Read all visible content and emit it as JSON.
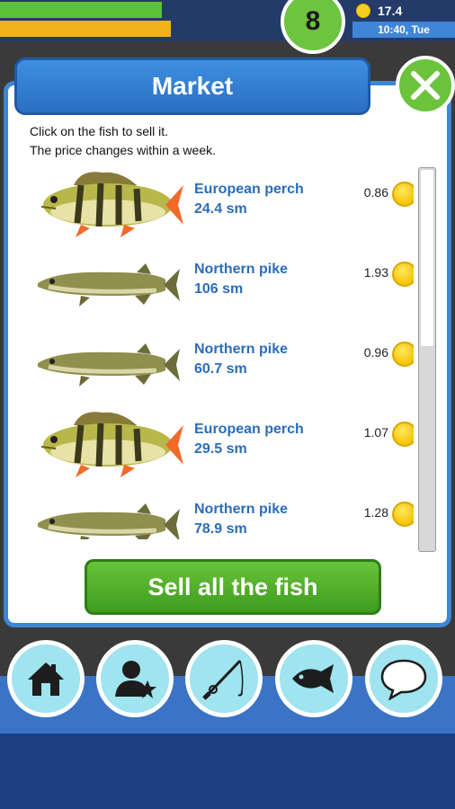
{
  "status": {
    "level": "8",
    "coins": "17.4",
    "time": "10:40, Tue"
  },
  "market": {
    "title": "Market",
    "intro_line1": "Click on the fish to sell it.",
    "intro_line2": "The price changes within a week.",
    "sell_all_label": "Sell all the fish",
    "fish": [
      {
        "name": "European perch",
        "size": "24.4 sm",
        "price": "0.86",
        "species_icon": "perch-image"
      },
      {
        "name": "Northern pike",
        "size": "106 sm",
        "price": "1.93",
        "species_icon": "pike-image"
      },
      {
        "name": "Northern pike",
        "size": "60.7 sm",
        "price": "0.96",
        "species_icon": "pike-image"
      },
      {
        "name": "European perch",
        "size": "29.5 sm",
        "price": "1.07",
        "species_icon": "perch-image"
      },
      {
        "name": "Northern pike",
        "size": "78.9 sm",
        "price": "1.28",
        "species_icon": "pike-image"
      }
    ],
    "list_scroll_fraction": 0.46
  },
  "nav": {
    "items": [
      "home-icon",
      "profile-star-icon",
      "fishing-rod-icon",
      "fish-icon",
      "chat-bubble-icon"
    ]
  },
  "colors": {
    "panel_border": "#3d86d6",
    "title_blue": "#2a6fc3",
    "sell_green": "#4fae28",
    "fish_name": "#2b6db7",
    "nav_circle": "#9fe4ee",
    "coin_yellow": "#f4c400"
  }
}
